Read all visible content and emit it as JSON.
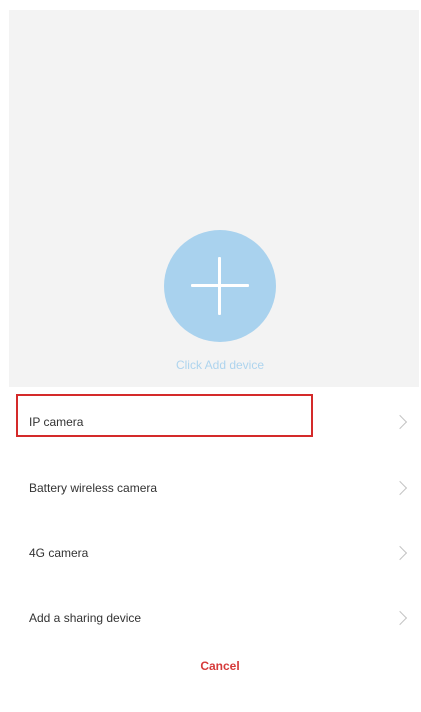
{
  "add_area": {
    "caption": "Click Add device",
    "button_color": "#a9d2ee"
  },
  "device_menu": {
    "items": [
      {
        "label": "IP camera",
        "highlighted": true
      },
      {
        "label": "Battery wireless camera"
      },
      {
        "label": "4G camera"
      },
      {
        "label": "Add a sharing device"
      }
    ],
    "cancel_label": "Cancel",
    "highlight_color": "#d42a2a",
    "cancel_color": "#d63a3a"
  }
}
